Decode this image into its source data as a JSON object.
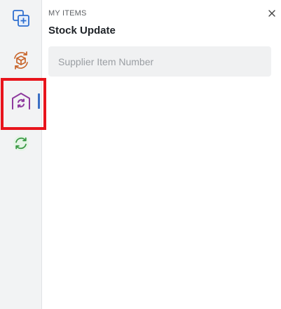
{
  "panel": {
    "eyebrow": "MY ITEMS",
    "title": "Stock Update",
    "search_placeholder": "Supplier Item Number"
  },
  "rail": {
    "items": [
      {
        "icon": "add-copy-icon",
        "color": "#2f6fd0"
      },
      {
        "icon": "package-sync-icon",
        "color": "#c8652b"
      },
      {
        "icon": "warehouse-sync-icon",
        "color": "#8e3a9e",
        "active": true
      },
      {
        "icon": "refresh-icon",
        "color": "#3a9a44"
      }
    ],
    "active_indicator_color": "#3b6fc4",
    "highlight_color": "#e8141c"
  }
}
